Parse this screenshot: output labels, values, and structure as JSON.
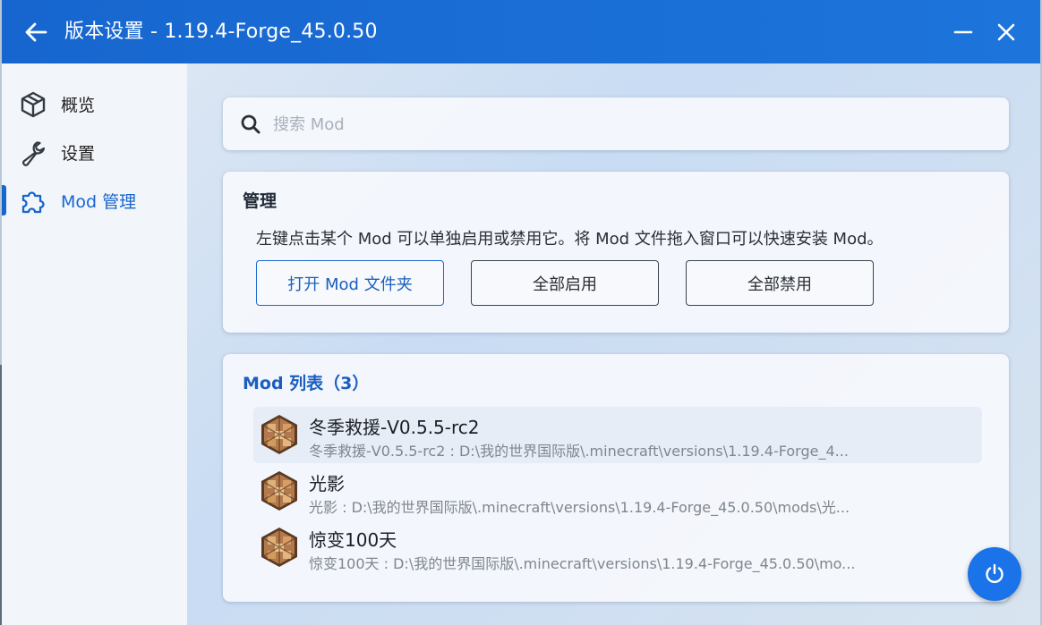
{
  "titlebar": {
    "title": "版本设置 - 1.19.4-Forge_45.0.50",
    "back_icon": "arrow-left-icon",
    "minimize_icon": "minimize-icon",
    "close_icon": "close-icon"
  },
  "sidebar": {
    "items": [
      {
        "label": "概览",
        "icon": "cube-icon",
        "active": false
      },
      {
        "label": "设置",
        "icon": "wrench-icon",
        "active": false
      },
      {
        "label": "Mod 管理",
        "icon": "puzzle-icon",
        "active": true
      }
    ]
  },
  "search": {
    "placeholder": "搜索 Mod",
    "value": ""
  },
  "manage": {
    "title": "管理",
    "description": "左键点击某个 Mod 可以单独启用或禁用它。将 Mod 文件拖入窗口可以快速安装 Mod。",
    "buttons": {
      "open_folder": "打开 Mod 文件夹",
      "enable_all": "全部启用",
      "disable_all": "全部禁用"
    }
  },
  "mod_list": {
    "title": "Mod 列表（3）",
    "items": [
      {
        "name": "冬季救援-V0.5.5-rc2",
        "path": "冬季救援-V0.5.5-rc2 : D:\\我的世界国际版\\.minecraft\\versions\\1.19.4-Forge_4..."
      },
      {
        "name": "光影",
        "path": "光影 : D:\\我的世界国际版\\.minecraft\\versions\\1.19.4-Forge_45.0.50\\mods\\光..."
      },
      {
        "name": "惊变100天",
        "path": "惊变100天 : D:\\我的世界国际版\\.minecraft\\versions\\1.19.4-Forge_45.0.50\\mo..."
      }
    ]
  },
  "fab_icon": "power-icon",
  "colors": {
    "accent": "#1766cf",
    "fab": "#1a73e8"
  }
}
